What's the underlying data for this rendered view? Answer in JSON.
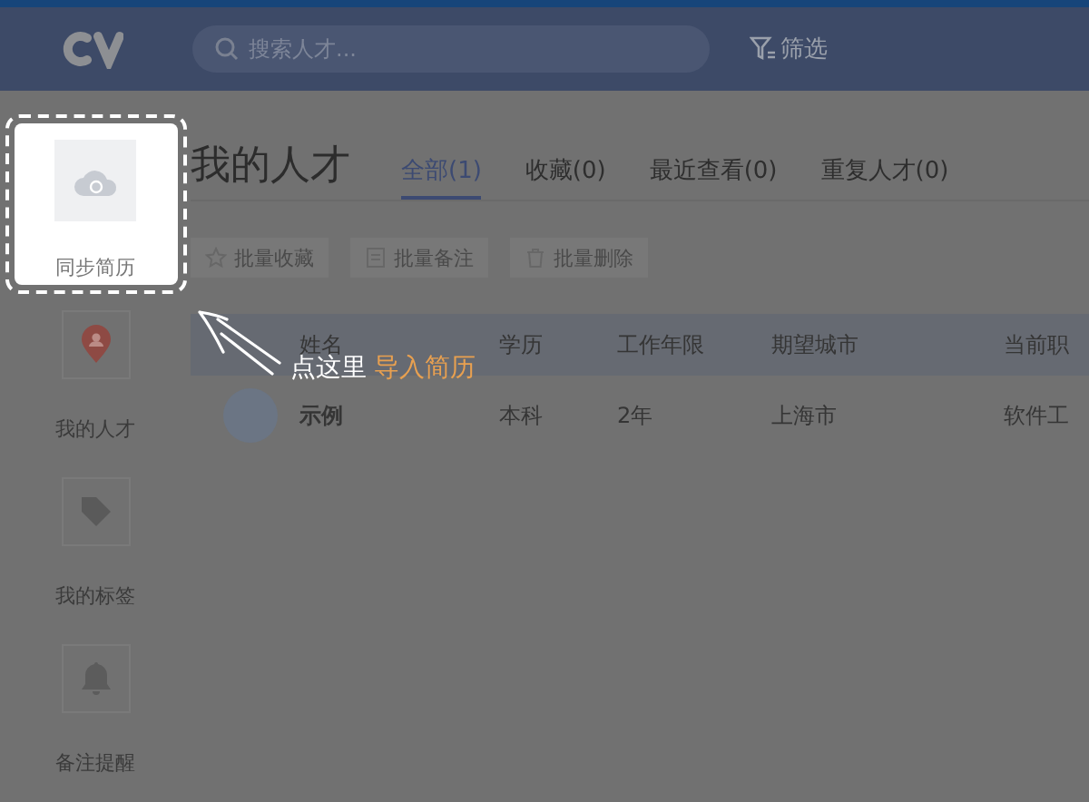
{
  "search": {
    "placeholder": "搜索人才..."
  },
  "filter": {
    "label": "筛选"
  },
  "sidebar": {
    "items": [
      {
        "label": "同步简历",
        "kind": "sync",
        "highlighted": true
      },
      {
        "label": "我的人才",
        "kind": "person",
        "highlighted": false
      },
      {
        "label": "我的标签",
        "kind": "tag",
        "highlighted": false
      },
      {
        "label": "备注提醒",
        "kind": "bell",
        "highlighted": false
      }
    ]
  },
  "page_title": "我的人才",
  "tabs": [
    {
      "label": "全部(1)",
      "selected": true
    },
    {
      "label": "收藏(0)",
      "selected": false
    },
    {
      "label": "最近查看(0)",
      "selected": false
    },
    {
      "label": "重复人才(0)",
      "selected": false
    }
  ],
  "actions": [
    {
      "label": "批量收藏",
      "kind": "star"
    },
    {
      "label": "批量备注",
      "kind": "note"
    },
    {
      "label": "批量删除",
      "kind": "trash"
    }
  ],
  "table": {
    "columns": [
      "姓名",
      "学历",
      "工作年限",
      "期望城市",
      "当前职"
    ],
    "rows": [
      [
        "示例",
        "本科",
        "2年",
        "上海市",
        "软件工"
      ]
    ]
  },
  "hint": {
    "text": "点这里",
    "highlight": "导入简历"
  }
}
